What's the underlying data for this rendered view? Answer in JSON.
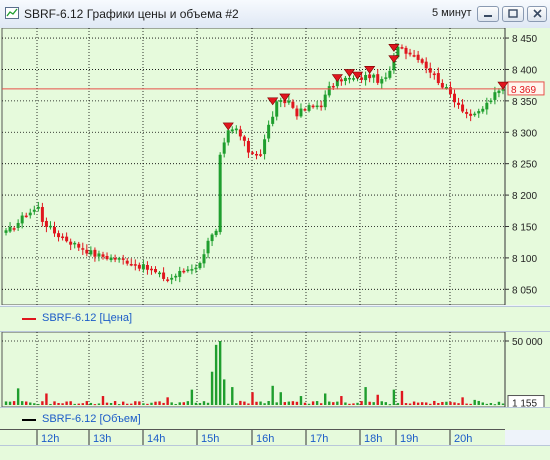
{
  "window": {
    "title": "SBRF-6.12 Графики цены и объема #2",
    "interval": "5 минут",
    "buttons": [
      "minimize",
      "maximize",
      "close"
    ]
  },
  "colors": {
    "panel_bg": "#e6fadc",
    "up": "#1f9e2e",
    "down": "#e0161e",
    "marker": "#e0161e",
    "current_price_line": "#e8504a",
    "legend_text": "#1c5cc8"
  },
  "price_legend": {
    "label": "SBRF-6.12 [Цена]"
  },
  "volume_legend": {
    "label": "SBRF-6.12 [Объем]"
  },
  "current_price_label": "8 369",
  "current_volume_label": "1 155",
  "chart_data": [
    {
      "type": "candlestick",
      "title": "",
      "series_name": "SBRF-6.12 [Цена]",
      "y_ticks": [
        "8 050",
        "8 100",
        "8 150",
        "8 200",
        "8 250",
        "8 300",
        "8 350",
        "8 400",
        "8 450"
      ],
      "ylim": [
        8025,
        8466
      ],
      "x_ticks": [
        "12h",
        "13h",
        "14h",
        "15h",
        "16h",
        "17h",
        "18h",
        "19h",
        "20h"
      ],
      "grid": true,
      "current_value": 8369,
      "anchors": [
        {
          "i": 0,
          "v": 8140
        },
        {
          "i": 2,
          "v": 8150
        },
        {
          "i": 5,
          "v": 8170
        },
        {
          "i": 8,
          "v": 8180
        },
        {
          "i": 9,
          "v": 8160
        },
        {
          "i": 12,
          "v": 8140
        },
        {
          "i": 16,
          "v": 8125
        },
        {
          "i": 22,
          "v": 8105
        },
        {
          "i": 30,
          "v": 8095
        },
        {
          "i": 36,
          "v": 8080
        },
        {
          "i": 40,
          "v": 8065
        },
        {
          "i": 44,
          "v": 8080
        },
        {
          "i": 48,
          "v": 8090
        },
        {
          "i": 50,
          "v": 8130
        },
        {
          "i": 52,
          "v": 8140
        },
        {
          "i": 53,
          "v": 8260
        },
        {
          "i": 55,
          "v": 8300
        },
        {
          "i": 57,
          "v": 8305
        },
        {
          "i": 60,
          "v": 8270
        },
        {
          "i": 63,
          "v": 8265
        },
        {
          "i": 65,
          "v": 8310
        },
        {
          "i": 67,
          "v": 8345
        },
        {
          "i": 70,
          "v": 8350
        },
        {
          "i": 72,
          "v": 8330
        },
        {
          "i": 75,
          "v": 8340
        },
        {
          "i": 78,
          "v": 8345
        },
        {
          "i": 80,
          "v": 8370
        },
        {
          "i": 83,
          "v": 8385
        },
        {
          "i": 87,
          "v": 8385
        },
        {
          "i": 90,
          "v": 8390
        },
        {
          "i": 93,
          "v": 8380
        },
        {
          "i": 95,
          "v": 8395
        },
        {
          "i": 97,
          "v": 8440
        },
        {
          "i": 99,
          "v": 8430
        },
        {
          "i": 102,
          "v": 8420
        },
        {
          "i": 106,
          "v": 8390
        },
        {
          "i": 110,
          "v": 8360
        },
        {
          "i": 114,
          "v": 8330
        },
        {
          "i": 116,
          "v": 8325
        },
        {
          "i": 119,
          "v": 8345
        },
        {
          "i": 121,
          "v": 8360
        },
        {
          "i": 123,
          "v": 8369
        }
      ],
      "markers": [
        {
          "i": 55,
          "v": 8307
        },
        {
          "i": 66,
          "v": 8347
        },
        {
          "i": 69,
          "v": 8353
        },
        {
          "i": 82,
          "v": 8384
        },
        {
          "i": 85,
          "v": 8392
        },
        {
          "i": 87,
          "v": 8388
        },
        {
          "i": 90,
          "v": 8397
        },
        {
          "i": 96,
          "v": 8432
        },
        {
          "i": 96,
          "v": 8414
        },
        {
          "i": 123,
          "v": 8372
        }
      ]
    },
    {
      "type": "bar",
      "title": "",
      "series_name": "SBRF-6.12 [Объем]",
      "y_ticks": [
        "50 000"
      ],
      "ylim": [
        0,
        50000
      ],
      "current_value": 1155,
      "spikes": [
        {
          "i": 3,
          "v": 13000
        },
        {
          "i": 10,
          "v": 9000
        },
        {
          "i": 24,
          "v": 7000
        },
        {
          "i": 40,
          "v": 6000
        },
        {
          "i": 46,
          "v": 12000
        },
        {
          "i": 51,
          "v": 26000
        },
        {
          "i": 52,
          "v": 47000
        },
        {
          "i": 53,
          "v": 50000
        },
        {
          "i": 54,
          "v": 20000
        },
        {
          "i": 56,
          "v": 14000
        },
        {
          "i": 61,
          "v": 10000
        },
        {
          "i": 66,
          "v": 15000
        },
        {
          "i": 68,
          "v": 10000
        },
        {
          "i": 73,
          "v": 7000
        },
        {
          "i": 79,
          "v": 9000
        },
        {
          "i": 83,
          "v": 7000
        },
        {
          "i": 89,
          "v": 14000
        },
        {
          "i": 92,
          "v": 8000
        },
        {
          "i": 96,
          "v": 12000
        },
        {
          "i": 98,
          "v": 11000
        },
        {
          "i": 113,
          "v": 6000
        },
        {
          "i": 116,
          "v": 4000
        }
      ]
    }
  ]
}
